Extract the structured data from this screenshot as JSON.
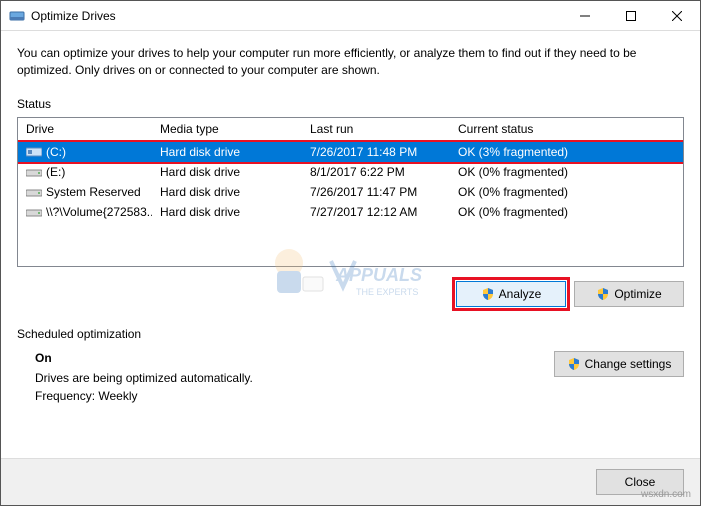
{
  "window": {
    "title": "Optimize Drives",
    "intro": "You can optimize your drives to help your computer run more efficiently, or analyze them to find out if they need to be optimized. Only drives on or connected to your computer are shown."
  },
  "status": {
    "label": "Status",
    "columns": {
      "drive": "Drive",
      "media": "Media type",
      "lastrun": "Last run",
      "status": "Current status"
    },
    "rows": [
      {
        "drive": "(C:)",
        "media": "Hard disk drive",
        "lastrun": "7/26/2017 11:48 PM",
        "status": "OK (3% fragmented)",
        "selected": true
      },
      {
        "drive": "(E:)",
        "media": "Hard disk drive",
        "lastrun": "8/1/2017 6:22 PM",
        "status": "OK (0% fragmented)",
        "selected": false
      },
      {
        "drive": "System Reserved",
        "media": "Hard disk drive",
        "lastrun": "7/26/2017 11:47 PM",
        "status": "OK (0% fragmented)",
        "selected": false
      },
      {
        "drive": "\\\\?\\Volume{272583...",
        "media": "Hard disk drive",
        "lastrun": "7/27/2017 12:12 AM",
        "status": "OK (0% fragmented)",
        "selected": false
      }
    ]
  },
  "actions": {
    "analyze": "Analyze",
    "optimize": "Optimize"
  },
  "scheduled": {
    "label": "Scheduled optimization",
    "on": "On",
    "desc": "Drives are being optimized automatically.",
    "freq": "Frequency: Weekly",
    "change": "Change settings"
  },
  "footer": {
    "close": "Close"
  },
  "attribution": "wsxdn.com"
}
